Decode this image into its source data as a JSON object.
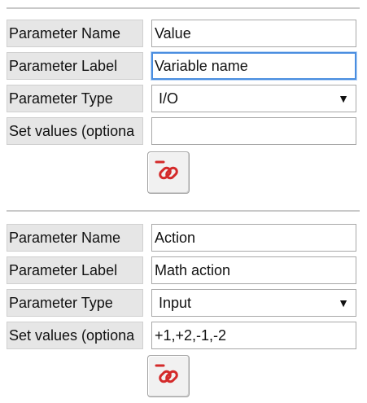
{
  "param_blocks": [
    {
      "name_label": "Parameter Name",
      "name_value": "Value",
      "label_label": "Parameter Label",
      "label_value": "Variable name",
      "type_label": "Parameter Type",
      "type_value": "I/O",
      "set_values_label": "Set values (optiona",
      "set_values_value": "",
      "link_icon": "unlink-icon"
    },
    {
      "name_label": "Parameter Name",
      "name_value": "Action",
      "label_label": "Parameter Label",
      "label_value": "Math action",
      "type_label": "Parameter Type",
      "type_value": "Input",
      "set_values_label": "Set values (optiona",
      "set_values_value": "+1,+2,-1,-2",
      "link_icon": "unlink-icon"
    }
  ],
  "colors": {
    "label_bg": "#e6e6e6",
    "focus_border": "#4a8ee0",
    "icon_red": "#d42a2a",
    "divider": "#c9c9c9"
  }
}
